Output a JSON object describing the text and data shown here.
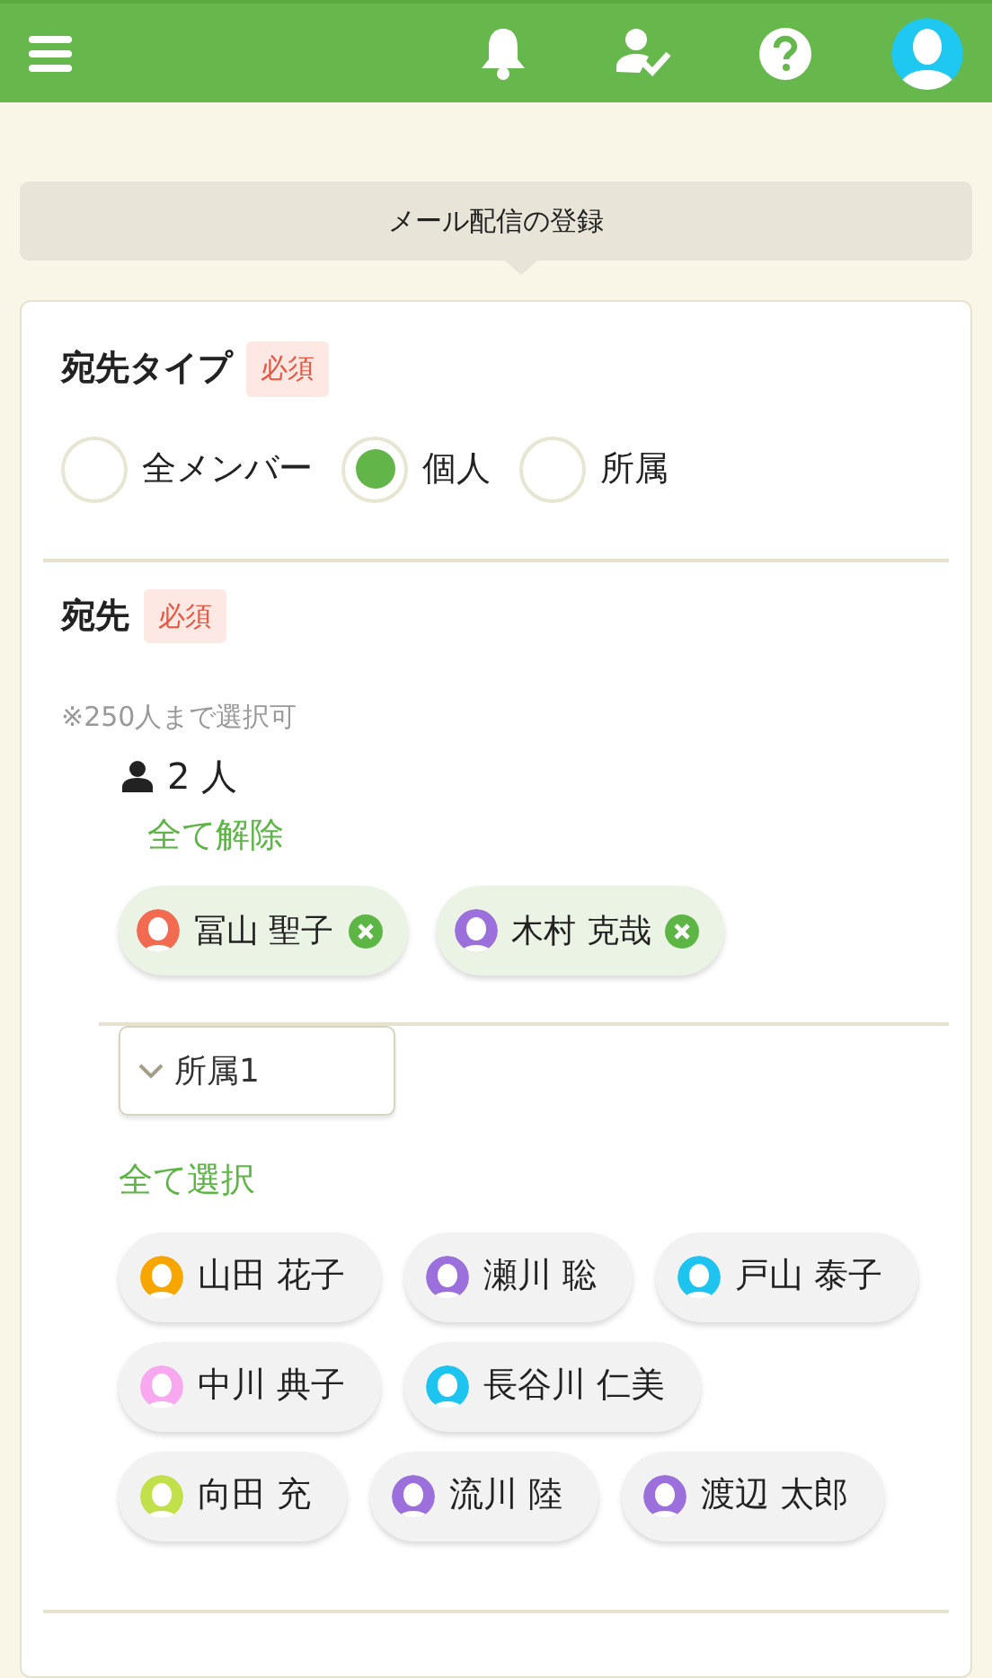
{
  "page_title": "メール配信の登録",
  "recipient_type": {
    "label": "宛先タイプ",
    "badge": "必須",
    "options": [
      {
        "label": "全メンバー",
        "selected": false
      },
      {
        "label": "個人",
        "selected": true
      },
      {
        "label": "所属",
        "selected": false
      }
    ]
  },
  "recipients": {
    "label": "宛先",
    "badge": "必須",
    "note": "※250人まで選択可",
    "count": "2 人",
    "clear_all": "全て解除",
    "selected": [
      {
        "name": "冨山 聖子",
        "color": "#f26a4f"
      },
      {
        "name": "木村 克哉",
        "color": "#9b6fdc"
      }
    ],
    "group": {
      "dropdown": "所属1",
      "select_all": "全て選択",
      "members": [
        {
          "name": "山田 花子",
          "color": "#f7a600"
        },
        {
          "name": "瀬川 聡",
          "color": "#9b6fdc"
        },
        {
          "name": "戸山 泰子",
          "color": "#1ec4f0"
        },
        {
          "name": "中川 典子",
          "color": "#f7a8ee"
        },
        {
          "name": "長谷川 仁美",
          "color": "#1ec4f0"
        },
        {
          "name": "向田 充",
          "color": "#c2e04a"
        },
        {
          "name": "流川 陸",
          "color": "#9b6fdc"
        },
        {
          "name": "渡辺 太郎",
          "color": "#9b6fdc"
        }
      ]
    }
  }
}
